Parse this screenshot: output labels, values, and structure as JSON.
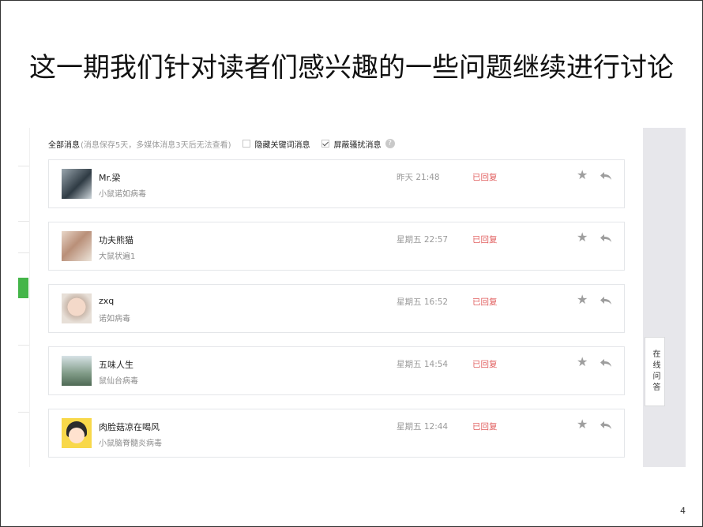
{
  "slide": {
    "title": "这一期我们针对读者们感兴趣的一些问题继续进行讨论",
    "page_number": "4"
  },
  "filter": {
    "all_messages": "全部消息",
    "note": "(消息保存5天，多媒体消息3天后无法查看)",
    "hide_keyword_label": "隐藏关键词消息",
    "hide_keyword_checked": false,
    "block_spam_label": "屏蔽骚扰消息",
    "block_spam_checked": true,
    "help_icon": "question-circle-icon"
  },
  "messages": [
    {
      "name": "Mr.梁",
      "preview": "小鼠诺如病毒",
      "time": "昨天 21:48",
      "status": "已回复"
    },
    {
      "name": "功夫熊猫",
      "preview": "大鼠状遍1",
      "time": "星期五 22:57",
      "status": "已回复"
    },
    {
      "name": "zxq",
      "preview": "诺如病毒",
      "time": "星期五 16:52",
      "status": "已回复"
    },
    {
      "name": "五味人生",
      "preview": "鼠仙台病毒",
      "time": "星期五 14:54",
      "status": "已回复"
    },
    {
      "name": "肉脸菇凉在喝风",
      "preview": "小鼠脑脊髓炎病毒",
      "time": "星期五 12:44",
      "status": "已回复"
    }
  ],
  "side_panel": {
    "online_qa": "在线问答"
  },
  "colors": {
    "accent_green": "#44b549",
    "status_red": "#e15f5f",
    "side_gray": "#e7e7eb"
  },
  "icons": {
    "star": "star-icon",
    "reply": "reply-icon"
  }
}
